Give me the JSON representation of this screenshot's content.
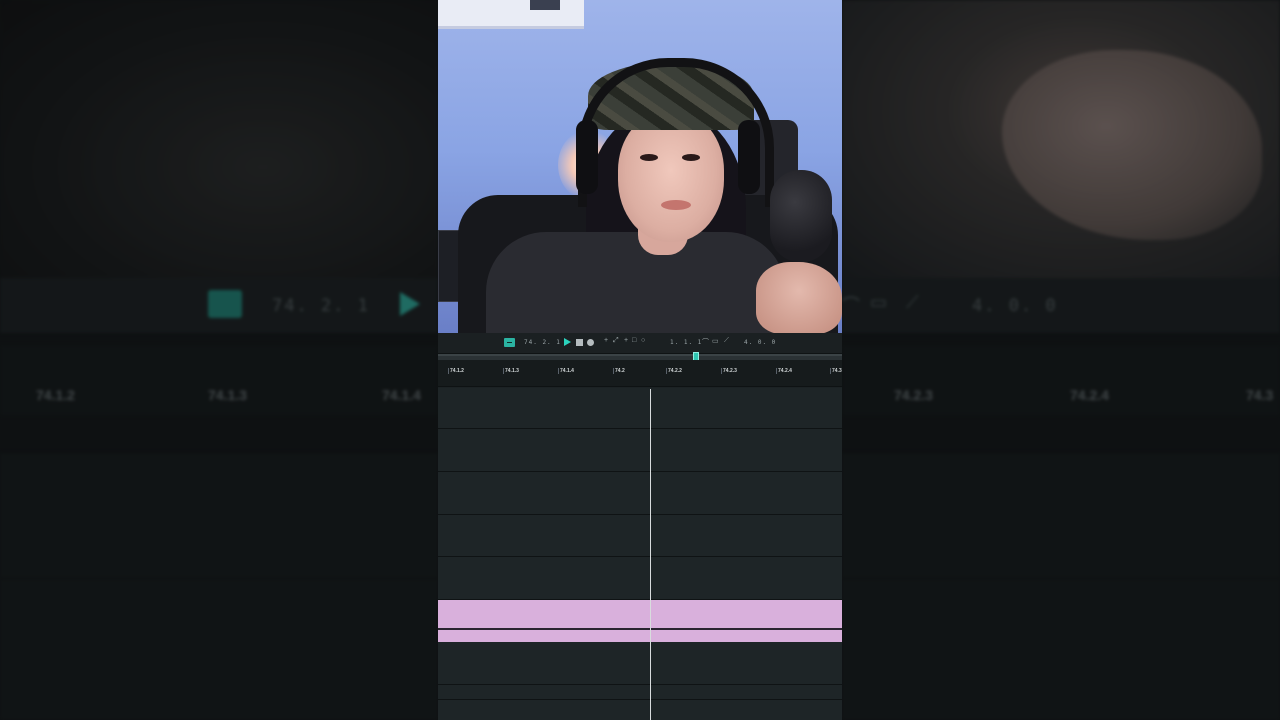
{
  "transport": {
    "position": "74. 2. 1",
    "loop_start": "1. 1. 1",
    "loop_length": "4. 0. 0",
    "accent_color": "#2bd3bd"
  },
  "ruler": {
    "ticks": [
      "74.1.2",
      "74.1.3",
      "74.1.4",
      "74.2",
      "74.2.2",
      "74.2.3",
      "74.2.4",
      "74.3"
    ]
  },
  "backdrop": {
    "left_position": "74. 2. 1",
    "right_length": "4. 0. 0",
    "left_ticks": [
      "74.1.2",
      "74.1.3",
      "74.1.4"
    ],
    "right_ticks": [
      "74.2.3",
      "74.2.4",
      "74.3"
    ]
  },
  "icons": [
    "loop-icon",
    "play-icon",
    "stop-icon",
    "record-icon",
    "pencil-icon",
    "pointer-icon",
    "curve-icon",
    "monitor-icon",
    "ramp-icon"
  ],
  "clip_color": "#d9b0dc"
}
